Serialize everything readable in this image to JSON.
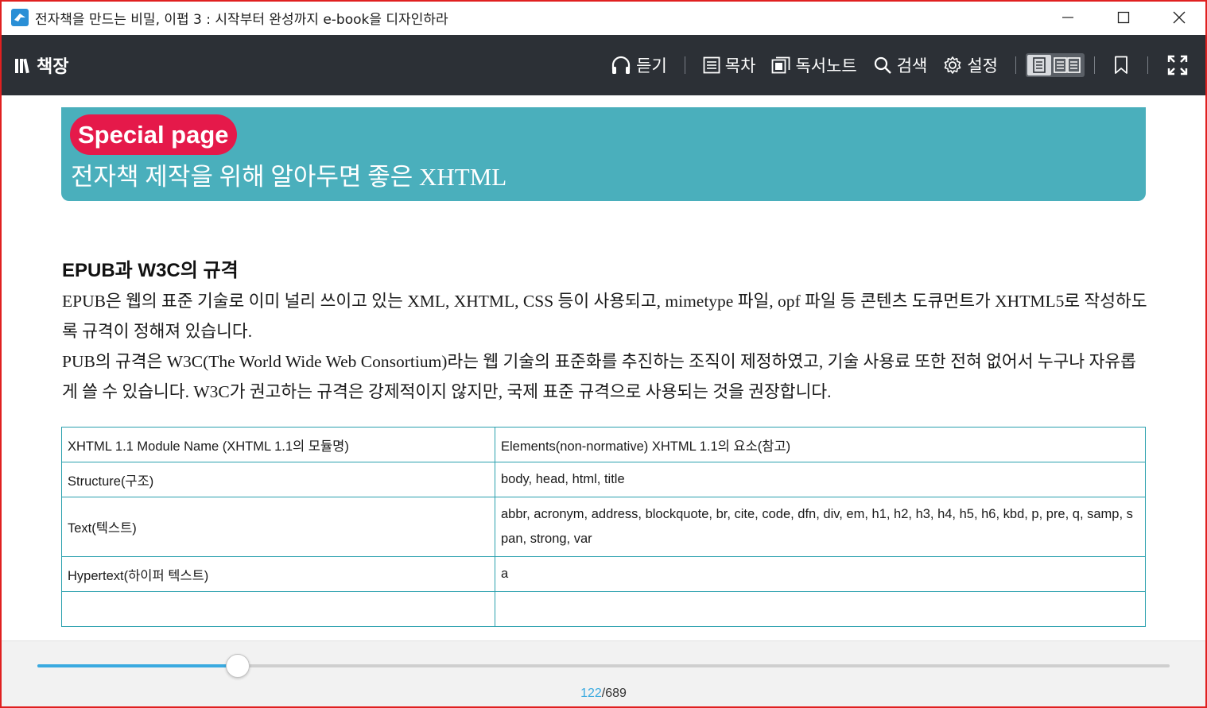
{
  "window": {
    "title": "전자책을 만드는 비밀, 이펍 3 : 시작부터 완성까지 e-book을 디자인하라",
    "controls": [
      "minimize-icon",
      "maximize-icon",
      "close-icon"
    ]
  },
  "toolbar": {
    "bookshelf_label": "책장",
    "listen_label": "듣기",
    "toc_label": "목차",
    "notes_label": "독서노트",
    "search_label": "검색",
    "settings_label": "설정",
    "view_mode": "single-page",
    "icons": [
      "library-icon",
      "headphones-icon",
      "list-icon",
      "notebook-icon",
      "search-icon",
      "gear-icon",
      "single-page-icon",
      "two-page-icon",
      "bookmark-icon",
      "fullscreen-icon"
    ]
  },
  "page": {
    "banner_pill": "Special page",
    "banner_title": "전자책 제작을 위해 알아두면 좋은 XHTML",
    "section_title": "EPUB과 W3C의 규격",
    "paragraphs": [
      "EPUB은 웹의 표준 기술로 이미 널리 쓰이고 있는 XML, XHTML, CSS 등이 사용되고, mimetype 파일, opf 파일 등 콘텐츠 도큐먼트가 XHTML5로 작성하도록 규격이 정해져 있습니다.",
      "PUB의 규격은 W3C(The World Wide Web Consortium)라는 웹 기술의 표준화를 추진하는 조직이 제정하였고, 기술 사용료 또한 전혀 없어서 누구나 자유롭게 쓸 수 있습니다. W3C가 권고하는 규격은 강제적이지 않지만, 국제 표준 규격으로 사용되는 것을 권장합니다."
    ],
    "table": {
      "header": [
        "XHTML 1.1 Module Name (XHTML 1.1의 모듈명)",
        "Elements(non-normative) XHTML 1.1의 요소(참고)"
      ],
      "rows": [
        [
          "Structure(구조)",
          "body, head, html, title"
        ],
        [
          "Text(텍스트)",
          "abbr, acronym, address, blockquote, br, cite, code, dfn, div, em, h1, h2, h3, h4, h5, h6, kbd, p, pre, q, samp, span, strong, var"
        ],
        [
          "Hypertext(하이퍼 텍스트)",
          "a"
        ],
        [
          "",
          ""
        ]
      ]
    }
  },
  "progress": {
    "current_page": "122",
    "separator": "/",
    "total_pages": "689",
    "fraction": 0.177,
    "accent_color": "#3aaae0"
  },
  "colors": {
    "banner": "#4aafbc",
    "pill": "#e5194a",
    "toolbar": "#2c3036",
    "table_border": "#2aa0ae"
  }
}
